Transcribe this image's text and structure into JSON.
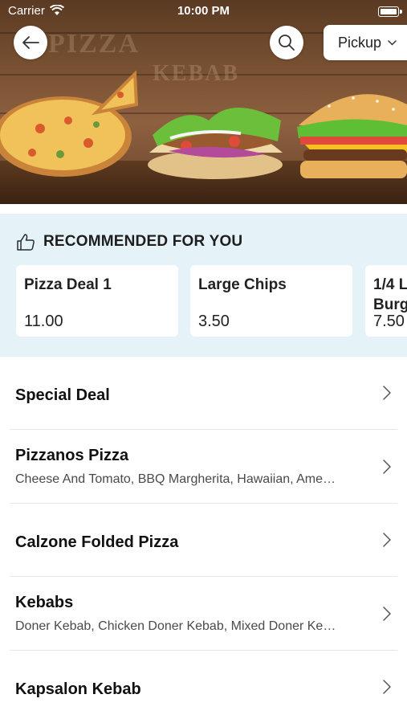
{
  "status_bar": {
    "carrier": "Carrier",
    "time": "10:00 PM"
  },
  "hero": {
    "banner_text_1": "PIZZA",
    "banner_text_2": "KEBAB"
  },
  "header": {
    "pickup_label": "Pickup"
  },
  "recommended": {
    "title": "RECOMMENDED FOR YOU",
    "items": [
      {
        "name": "Pizza Deal 1",
        "price": "11.00"
      },
      {
        "name": "Large Chips",
        "price": "3.50"
      },
      {
        "name": "1/4 L Burg",
        "price": "7.50"
      }
    ]
  },
  "menu": {
    "categories": [
      {
        "title": "Special Deal",
        "subtitle": ""
      },
      {
        "title": "Pizzanos Pizza",
        "subtitle": "Cheese And Tomato, BBQ Margherita, Hawaiian, Ame…"
      },
      {
        "title": "Calzone Folded Pizza",
        "subtitle": ""
      },
      {
        "title": "Kebabs",
        "subtitle": "Doner Kebab, Chicken Doner Kebab, Mixed Doner Ke…"
      },
      {
        "title": "Kapsalon Kebab",
        "subtitle": ""
      }
    ]
  },
  "colors": {
    "accent_bg": "#e5f2f8",
    "hero_wood": "#7a5233"
  }
}
